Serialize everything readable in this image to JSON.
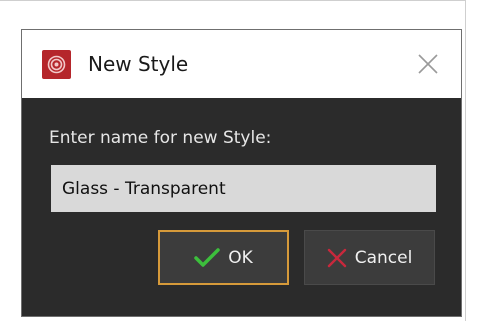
{
  "window": {
    "title": "New Style",
    "icon": "app-logo-icon",
    "close_icon": "close-icon"
  },
  "form": {
    "label": "Enter name for new Style:",
    "name_value": "Glass - Transparent"
  },
  "buttons": {
    "ok_label": "OK",
    "ok_icon": "checkmark-icon",
    "cancel_label": "Cancel",
    "cancel_icon": "x-icon"
  },
  "colors": {
    "dialog_background": "#2b2b2b",
    "titlebar_background": "#ffffff",
    "app_icon": "#b5262b",
    "ok_focus_border": "#d69a3a",
    "ok_check": "#3cbf3c",
    "cancel_x": "#c8283c"
  }
}
